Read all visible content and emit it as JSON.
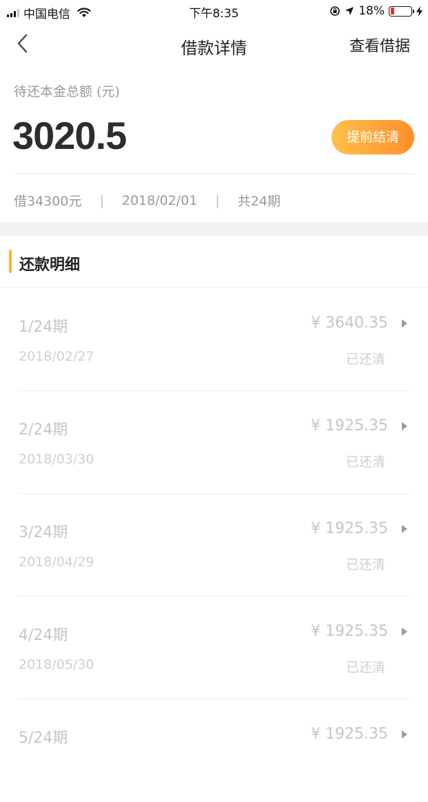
{
  "status_bar": {
    "carrier": "中国电信",
    "time": "下午8:35",
    "battery": "18%",
    "battery_level": 0.18,
    "icons": [
      "signal-icon",
      "wifi-icon",
      "orientation-lock-icon",
      "location-arrow-icon",
      "battery-icon",
      "charging-bolt-icon"
    ]
  },
  "nav": {
    "title": "借款详情",
    "action": "查看借据",
    "back_icon": "chevron-left-icon"
  },
  "summary": {
    "label": "待还本金总额 (元)",
    "amount": "3020.5",
    "settle_button": "提前结清",
    "loan": "借34300元",
    "date": "2018/02/01",
    "periods": "共24期",
    "separator": "|"
  },
  "section": {
    "title": "还款明细"
  },
  "installments": [
    {
      "period": "1/24期",
      "date": "2018/02/27",
      "amount": "¥ 3640.35",
      "status": "已还清"
    },
    {
      "period": "2/24期",
      "date": "2018/03/30",
      "amount": "¥ 1925.35",
      "status": "已还清"
    },
    {
      "period": "3/24期",
      "date": "2018/04/29",
      "amount": "¥ 1925.35",
      "status": "已还清"
    },
    {
      "period": "4/24期",
      "date": "2018/05/30",
      "amount": "¥ 1925.35",
      "status": "已还清"
    },
    {
      "period": "5/24期",
      "date": "",
      "amount": "¥ 1925.35",
      "status": ""
    }
  ],
  "colors": {
    "accent": "#f6b92a",
    "button_start": "#ffc04a",
    "button_end": "#ff8f2a",
    "battery_low": "#e3301e"
  }
}
